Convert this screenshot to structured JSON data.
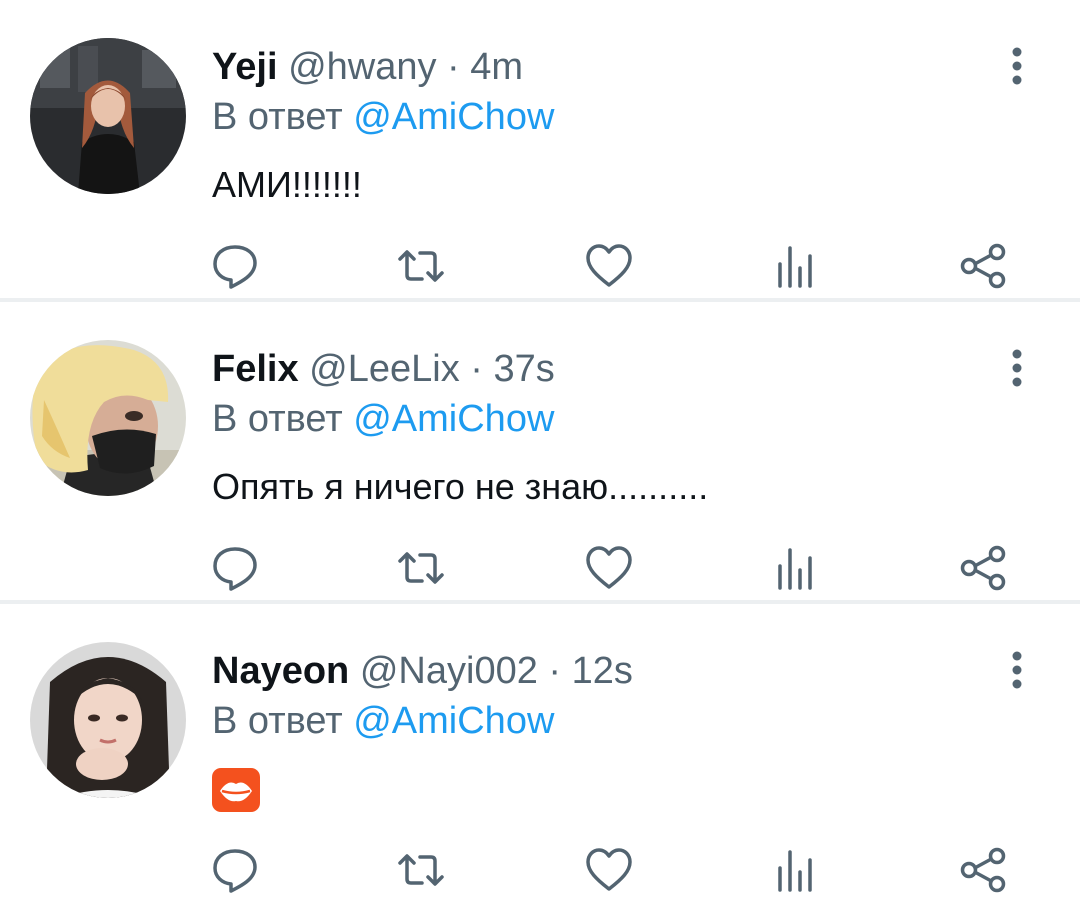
{
  "tweets": [
    {
      "name": "Yeji",
      "handle": "@hwany",
      "separator": "·",
      "time": "4m",
      "reply_prefix": "В ответ",
      "reply_to": "@AmiChow",
      "text": "АМИ!!!!!!!"
    },
    {
      "name": "Felix",
      "handle": "@LeeLix",
      "separator": "·",
      "time": "37s",
      "reply_prefix": "В ответ",
      "reply_to": "@AmiChow",
      "text": "Опять я ничего не знаю.........."
    },
    {
      "name": "Nayeon",
      "handle": "@Nayi002",
      "separator": "·",
      "time": "12s",
      "reply_prefix": "В ответ",
      "reply_to": "@AmiChow",
      "text": "💋",
      "text_icon": "kiss-mark-icon"
    }
  ],
  "actions": [
    "reply-icon",
    "retweet-icon",
    "like-icon",
    "stats-icon",
    "share-icon"
  ],
  "menu_icon": "more-vertical-icon",
  "colors": {
    "name": "#0f1419",
    "meta": "#536471",
    "link": "#1d9bf0",
    "icon": "#536471",
    "divider": "#eceff1",
    "kiss": "#f4511e"
  }
}
